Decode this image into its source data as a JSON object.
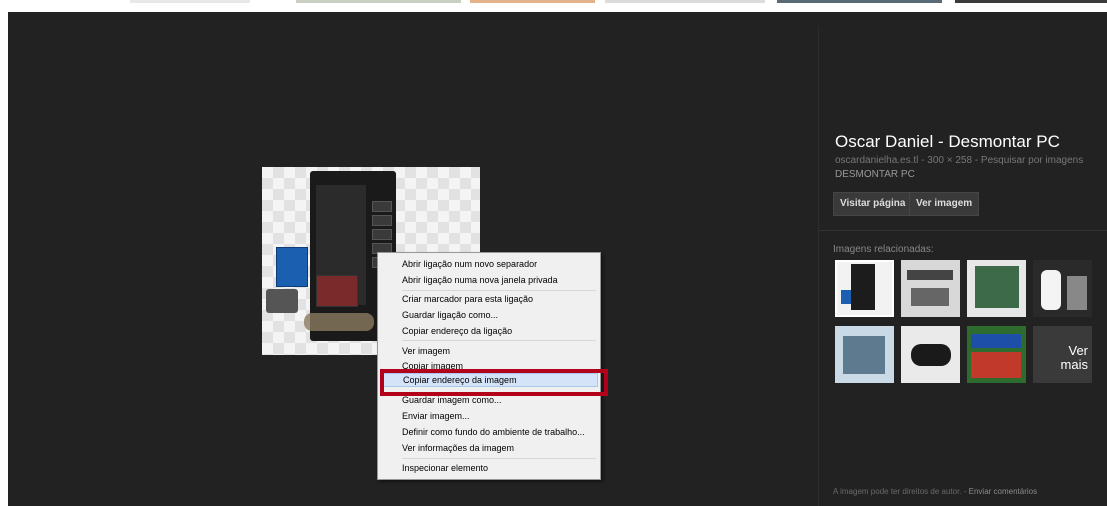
{
  "details": {
    "title": "Oscar Daniel - Desmontar PC",
    "source": "oscardanielha.es.tl - 300 × 258 - Pesquisar por imagens",
    "caption": "DESMONTAR PC",
    "visit_label": "Visitar página",
    "view_label": "Ver imagem"
  },
  "related": {
    "label": "Imagens relacionadas:",
    "more_line1": "Ver",
    "more_line2": "mais"
  },
  "footer": {
    "notice": "A imagem pode ter direitos de autor.",
    "separator": " - ",
    "feedback": "Enviar comentários"
  },
  "context_menu": {
    "items": [
      "Abrir ligação num novo separador",
      "Abrir ligação numa nova janela privada",
      "Criar marcador para esta ligação",
      "Guardar ligação como...",
      "Copiar endereço da ligação",
      "Ver imagem",
      "Copiar imagem",
      "Copiar endereço da imagem",
      "Guardar imagem como...",
      "Enviar imagem...",
      "Definir como fundo do ambiente de trabalho...",
      "Ver informações da imagem",
      "Inspecionar elemento"
    ],
    "highlighted": "Copiar endereço da imagem"
  },
  "colors": {
    "panel_bg": "#222222",
    "menu_bg": "#f0f0f0",
    "highlight_box": "#b3001b",
    "menu_highlight": "#d4e3f7"
  }
}
